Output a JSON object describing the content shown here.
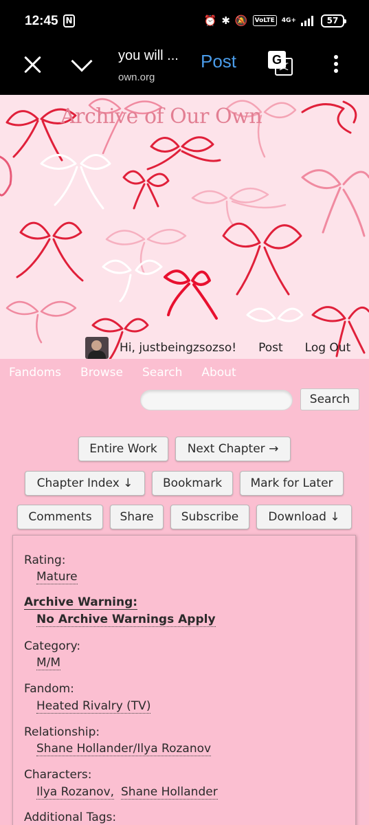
{
  "status_bar": {
    "time": "12:45",
    "n_badge": "N",
    "volte": "VoLTE",
    "network": "4G+",
    "battery": "57",
    "icons": [
      "alarm-icon",
      "bluetooth-icon",
      "mute-icon",
      "volte-icon",
      "signal-icon",
      "battery-icon"
    ]
  },
  "browser": {
    "page_title": "you will ...",
    "url": "own.org",
    "post_label": "Post",
    "translate_glyph": "G",
    "translate_glyph2": "文"
  },
  "header": {
    "site_title": "Archive of Our Own",
    "greeting": "Hi, justbeingzsozso!",
    "post_link": "Post",
    "logout_link": "Log Out"
  },
  "primary_nav": {
    "links": [
      "Fandoms",
      "Browse",
      "Search",
      "About"
    ],
    "search_button": "Search"
  },
  "actions": {
    "entire_work": "Entire Work",
    "next_chapter": "Next Chapter →",
    "chapter_index": "Chapter Index ↓",
    "bookmark": "Bookmark",
    "mark_for_later": "Mark for Later",
    "comments": "Comments",
    "share": "Share",
    "subscribe": "Subscribe",
    "download": "Download ↓"
  },
  "meta": {
    "rating_label": "Rating:",
    "rating_value": "Mature",
    "warning_label": "Archive Warning:",
    "warning_value": "No Archive Warnings Apply",
    "category_label": "Category:",
    "category_value": "M/M",
    "fandom_label": "Fandom:",
    "fandom_value": "Heated Rivalry (TV)",
    "relationship_label": "Relationship:",
    "relationship_value": "Shane Hollander/Ilya Rozanov",
    "characters_label": "Characters:",
    "character_1": "Ilya Rozanov,",
    "character_2": "Shane Hollander",
    "additional_tags_label": "Additional Tags:"
  },
  "colors": {
    "page_bg": "#fbbfd1",
    "header_bg": "#fde3ea",
    "ribbon_red": "#e0203a",
    "ribbon_pink": "#f08aa0",
    "link_blue": "#4a9be8"
  }
}
